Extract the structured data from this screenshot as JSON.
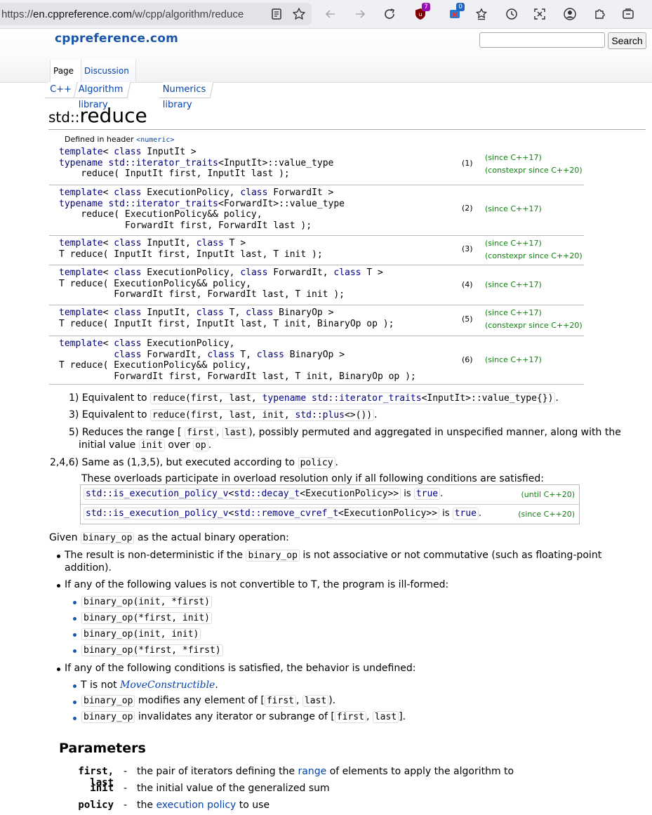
{
  "browser": {
    "url_prefix": "https://",
    "url_host": "en.cppreference.com",
    "url_path": "/w/cpp/algorithm/reduce",
    "ext_badge_1": "7",
    "ext_badge_2": "0"
  },
  "site": {
    "logo": "cppreference.com",
    "search_placeholder": "",
    "search_button": "Search",
    "tabs": {
      "page": "Page",
      "discussion": "Discussion"
    },
    "breadcrumbs": [
      "C++",
      "Algorithm library",
      "Numerics library"
    ]
  },
  "page": {
    "title_ns": "std::",
    "title_name": "reduce",
    "defined_in_prefix": "Defined in header ",
    "defined_in_header": "<numeric>"
  },
  "declarations": [
    {
      "num": "(1)",
      "since": [
        "(since C++17)",
        "(constexpr since C++20)"
      ]
    },
    {
      "num": "(2)",
      "since": [
        "(since C++17)"
      ]
    },
    {
      "num": "(3)",
      "since": [
        "(since C++17)",
        "(constexpr since C++20)"
      ]
    },
    {
      "num": "(4)",
      "since": [
        "(since C++17)"
      ]
    },
    {
      "num": "(5)",
      "since": [
        "(since C++17)",
        "(constexpr since C++20)"
      ]
    },
    {
      "num": "(6)",
      "since": [
        "(since C++17)"
      ]
    }
  ],
  "desc": {
    "item1_label": "1)",
    "item1_text": "Equivalent to",
    "item3_label": "3)",
    "item3_text": "Equivalent to",
    "item5_label": "5)",
    "item5_text_a": "Reduces the range [",
    "item5_text_b": "), possibly permuted and aggregated in unspecified manner, along with the",
    "item5_text_c": "initial value",
    "item5_text_d": "over",
    "item246_label": "2,4,6)",
    "item246_text": "Same as (1,3,5), but executed according to",
    "overload_note": "These overloads participate in overload resolution only if all following conditions are satisfied:",
    "cond1_is": "is",
    "cond1_rev": "(until C++20)",
    "cond2_is": "is",
    "cond2_rev": "(since C++20)",
    "true_word": "true"
  },
  "given": {
    "intro_a": "Given",
    "intro_b": "as the actual binary operation:",
    "b1_a": "The result is non-deterministic if the",
    "b1_b": "is not associative or not commutative (such as floating-point",
    "b1_c": "addition).",
    "b2": "If any of the following values is not convertible to T, the program is ill-formed:",
    "sub_values": [
      "binary_op(init, *first)",
      "binary_op(*first, init)",
      "binary_op(init, init)",
      "binary_op(*first, *first)"
    ],
    "b3": "If any of the following conditions is satisfied, the behavior is undefined:",
    "u1_a": "T is not",
    "u1_link": "MoveConstructible",
    "u2_b": "modifies any element of [",
    "u3_b": "invalidates any iterator or subrange of ["
  },
  "params": {
    "header": "Parameters",
    "rows": [
      {
        "name": "first, last",
        "dash": "-",
        "desc_a": "the pair of iterators defining the ",
        "link": "range",
        "desc_b": " of elements to apply the algorithm to"
      },
      {
        "name": "init",
        "dash": "-",
        "desc_a": "the initial value of the generalized sum",
        "link": "",
        "desc_b": ""
      },
      {
        "name": "policy",
        "dash": "-",
        "desc_a": "the ",
        "link": "execution policy",
        "desc_b": " to use"
      }
    ]
  },
  "colors": {
    "link": "#0645ad",
    "keyword": "#00007f",
    "since": "#118011",
    "logo": "#1a56a8"
  }
}
